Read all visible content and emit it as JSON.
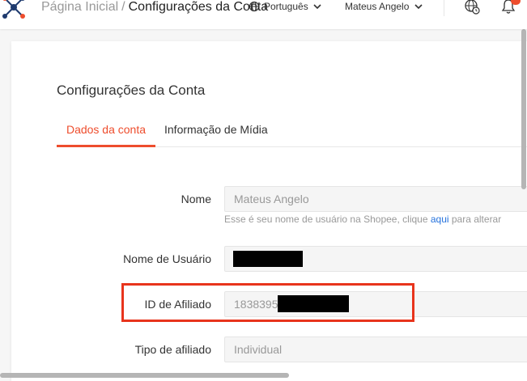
{
  "header": {
    "breadcrumb_home": "Página Inicial",
    "breadcrumb_sep": "/",
    "breadcrumb_current": "Configurações da Conta",
    "language": "Português",
    "user_name": "Mateus Angelo",
    "icons": [
      "logo-icon",
      "globe-icon",
      "chevron-down-icon",
      "globe-clock-icon",
      "bell-icon"
    ],
    "notification_dot_color": "#ee4d2d"
  },
  "page": {
    "title": "Configurações da Conta",
    "tabs": [
      {
        "label": "Dados da conta",
        "active": true
      },
      {
        "label": "Informação de Mídia",
        "active": false
      }
    ]
  },
  "form": {
    "name": {
      "label": "Nome",
      "value": "Mateus Angelo",
      "hint_prefix": "Esse é seu nome de usuário na Shopee, clique ",
      "hint_link": "aqui",
      "hint_suffix": " para alterar"
    },
    "username": {
      "label": "Nome de Usuário",
      "value": ""
    },
    "affiliate_id": {
      "label": "ID de Afiliado",
      "value_visible": "1838395"
    },
    "affiliate_type": {
      "label": "Tipo de afiliado",
      "value": "Individual"
    }
  },
  "colors": {
    "accent": "#ee4d2d",
    "link": "#2673dd",
    "highlight_box": "#e8341c"
  }
}
